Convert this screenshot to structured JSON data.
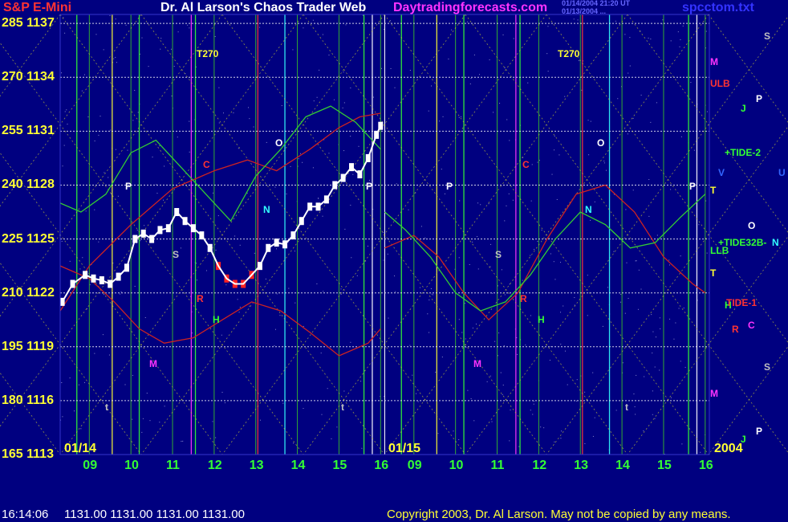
{
  "header": {
    "left": "S&P E-Mini",
    "center": "Dr. Al Larson's Chaos Trader Web",
    "site": "Daytradingforecasts.com",
    "stamp1": "01/14/2004 21:20 UT",
    "stamp2": "01/13/2004 ...",
    "file": "spcctom.txt"
  },
  "footer": {
    "time": "16:14:06",
    "ohlc": "1131.00 1131.00 1131.00 1131.00",
    "copyright": "Copyright 2003, Dr. Al Larson. May not be copied by any means."
  },
  "y_labels": [
    {
      "deg": "285",
      "price": "1137"
    },
    {
      "deg": "270",
      "price": "1134"
    },
    {
      "deg": "255",
      "price": "1131"
    },
    {
      "deg": "240",
      "price": "1128"
    },
    {
      "deg": "225",
      "price": "1125"
    },
    {
      "deg": "210",
      "price": "1122"
    },
    {
      "deg": "195",
      "price": "1119"
    },
    {
      "deg": "180",
      "price": "1116"
    },
    {
      "deg": "165",
      "price": "1113"
    }
  ],
  "x_labels": [
    "09",
    "10",
    "11",
    "12",
    "13",
    "14",
    "15",
    "16",
    "09",
    "10",
    "11",
    "12",
    "13",
    "14",
    "15",
    "16"
  ],
  "dates": [
    "01/14",
    "01/15"
  ],
  "year": "2004",
  "chart_labels": [
    {
      "t": "T270",
      "c": "#ffff33"
    },
    {
      "t": "T270",
      "c": "#ffff33"
    },
    {
      "t": "C",
      "c": "#ff3333"
    },
    {
      "t": "C",
      "c": "#ff3333"
    },
    {
      "t": "O",
      "c": "#ffffff"
    },
    {
      "t": "O",
      "c": "#ffffff"
    },
    {
      "t": "P",
      "c": "#ffffff"
    },
    {
      "t": "P",
      "c": "#ffffff"
    },
    {
      "t": "P",
      "c": "#ffffff"
    },
    {
      "t": "P",
      "c": "#ffffff"
    },
    {
      "t": "N",
      "c": "#33ffff"
    },
    {
      "t": "N",
      "c": "#33ffff"
    },
    {
      "t": "S",
      "c": "#c0c0c0"
    },
    {
      "t": "S",
      "c": "#c0c0c0"
    },
    {
      "t": "R",
      "c": "#ff3333"
    },
    {
      "t": "R",
      "c": "#ff3333"
    },
    {
      "t": "H",
      "c": "#33ff33"
    },
    {
      "t": "H",
      "c": "#33ff33"
    },
    {
      "t": "M",
      "c": "#ff33ff"
    },
    {
      "t": "M",
      "c": "#ff33ff"
    },
    {
      "t": "t",
      "c": "#c0c0c0"
    },
    {
      "t": "t",
      "c": "#c0c0c0"
    },
    {
      "t": "t",
      "c": "#c0c0c0"
    }
  ],
  "side_labels": [
    {
      "t": "S",
      "c": "#c0c0c0"
    },
    {
      "t": "M",
      "c": "#ff33ff"
    },
    {
      "t": "ULB",
      "c": "#ff3333"
    },
    {
      "t": "P",
      "c": "#ffffff"
    },
    {
      "t": "J",
      "c": "#33ff33"
    },
    {
      "t": "+TIDE-2",
      "c": "#33ff33"
    },
    {
      "t": "V",
      "c": "#3366ff"
    },
    {
      "t": "U",
      "c": "#3366ff"
    },
    {
      "t": "T",
      "c": "#ffff33"
    },
    {
      "t": "O",
      "c": "#ffffff"
    },
    {
      "t": "+TIDE32B-",
      "c": "#33ff33"
    },
    {
      "t": "N",
      "c": "#33ffff"
    },
    {
      "t": "LLB",
      "c": "#33ff33"
    },
    {
      "t": "T",
      "c": "#ffff33"
    },
    {
      "t": "H",
      "c": "#33ff33"
    },
    {
      "t": "TIDE-1",
      "c": "#ff3333"
    },
    {
      "t": "R",
      "c": "#ff3333"
    },
    {
      "t": "C",
      "c": "#ff33ff"
    },
    {
      "t": "S",
      "c": "#c0c0c0"
    },
    {
      "t": "M",
      "c": "#ff33ff"
    },
    {
      "t": "J",
      "c": "#33ff33"
    },
    {
      "t": "P",
      "c": "#ffffff"
    }
  ],
  "chart_data": {
    "type": "line",
    "title": "S&P E-Mini",
    "ylim": [
      1113,
      1137.5
    ],
    "xlim": [
      8.3,
      16.1
    ],
    "sessions": [
      "01/14",
      "01/15"
    ],
    "price_series": [
      {
        "name": "price",
        "day": 0,
        "x": [
          8.35,
          8.6,
          8.9,
          9.1,
          9.3,
          9.5,
          9.7,
          9.9,
          10.1,
          10.3,
          10.5,
          10.7,
          10.9,
          11.1,
          11.3,
          11.5,
          11.7,
          11.9,
          12.1,
          12.3,
          12.5,
          12.7,
          12.9,
          13.1,
          13.3,
          13.5,
          13.7,
          13.9,
          14.1,
          14.3,
          14.5,
          14.7,
          14.9,
          15.1,
          15.3,
          15.5,
          15.7,
          15.9,
          16.0
        ],
        "y": [
          1121.5,
          1122.5,
          1123.0,
          1122.8,
          1122.7,
          1122.5,
          1122.9,
          1123.4,
          1125.0,
          1125.3,
          1125.0,
          1125.5,
          1125.6,
          1126.5,
          1126.0,
          1125.6,
          1125.2,
          1124.5,
          1123.5,
          1122.8,
          1122.5,
          1122.5,
          1123.0,
          1123.5,
          1124.5,
          1124.8,
          1124.7,
          1125.2,
          1126.0,
          1126.8,
          1126.8,
          1127.2,
          1128.0,
          1128.4,
          1129.0,
          1128.6,
          1129.5,
          1130.8,
          1131.3
        ]
      }
    ],
    "overlay_lines": [
      {
        "name": "ULB",
        "color": "#cc2222",
        "day": 0,
        "x": [
          8.3,
          9.0,
          9.6,
          10.2,
          10.8,
          11.5,
          12.2,
          12.9,
          13.6,
          14.3,
          15.0,
          15.7,
          16.0
        ],
        "y": [
          1123.5,
          1122.8,
          1121.5,
          1120.0,
          1119.2,
          1119.5,
          1120.5,
          1121.5,
          1121.0,
          1119.8,
          1118.5,
          1119.2,
          1120.0
        ]
      },
      {
        "name": "TIDE-1",
        "color": "#cc2222",
        "day": 0,
        "x": [
          8.3,
          9.0,
          10.0,
          11.0,
          12.0,
          12.8,
          13.5,
          14.3,
          15.0,
          15.5,
          16.0
        ],
        "y": [
          1121.0,
          1123.5,
          1125.8,
          1127.8,
          1128.8,
          1129.4,
          1128.8,
          1130.0,
          1131.2,
          1131.8,
          1132.0
        ]
      },
      {
        "name": "TIDE-2",
        "color": "#33cc33",
        "day": 0,
        "x": [
          8.3,
          8.8,
          9.4,
          10.0,
          10.6,
          11.2,
          11.8,
          12.4,
          13.0,
          13.6,
          14.2,
          14.8,
          15.4,
          16.0
        ],
        "y": [
          1127.0,
          1126.5,
          1127.5,
          1129.8,
          1130.5,
          1129.0,
          1127.5,
          1126.0,
          1128.5,
          1130.0,
          1131.8,
          1132.4,
          1131.5,
          1130.0
        ]
      },
      {
        "name": "ULB",
        "color": "#cc2222",
        "day": 1,
        "x": [
          8.3,
          9.0,
          9.6,
          10.2,
          10.8,
          11.5,
          12.2,
          12.9,
          13.6,
          14.3,
          15.0,
          15.7,
          16.0
        ],
        "y": [
          1124.5,
          1125.2,
          1124.0,
          1122.0,
          1120.5,
          1122.0,
          1125.0,
          1127.5,
          1128.0,
          1126.5,
          1124.0,
          1122.5,
          1122.0
        ]
      },
      {
        "name": "TIDE-2",
        "color": "#33cc33",
        "day": 1,
        "x": [
          8.3,
          8.8,
          9.4,
          10.0,
          10.6,
          11.2,
          11.8,
          12.4,
          13.0,
          13.6,
          14.2,
          14.8,
          15.4,
          16.0
        ],
        "y": [
          1126.5,
          1125.5,
          1124.0,
          1122.0,
          1121.0,
          1121.5,
          1123.0,
          1125.0,
          1126.5,
          1125.8,
          1124.5,
          1124.8,
          1126.2,
          1127.5
        ]
      }
    ],
    "horizontal_levels": [
      1137,
      1134,
      1131,
      1128,
      1125,
      1122,
      1119,
      1116,
      1113
    ]
  }
}
